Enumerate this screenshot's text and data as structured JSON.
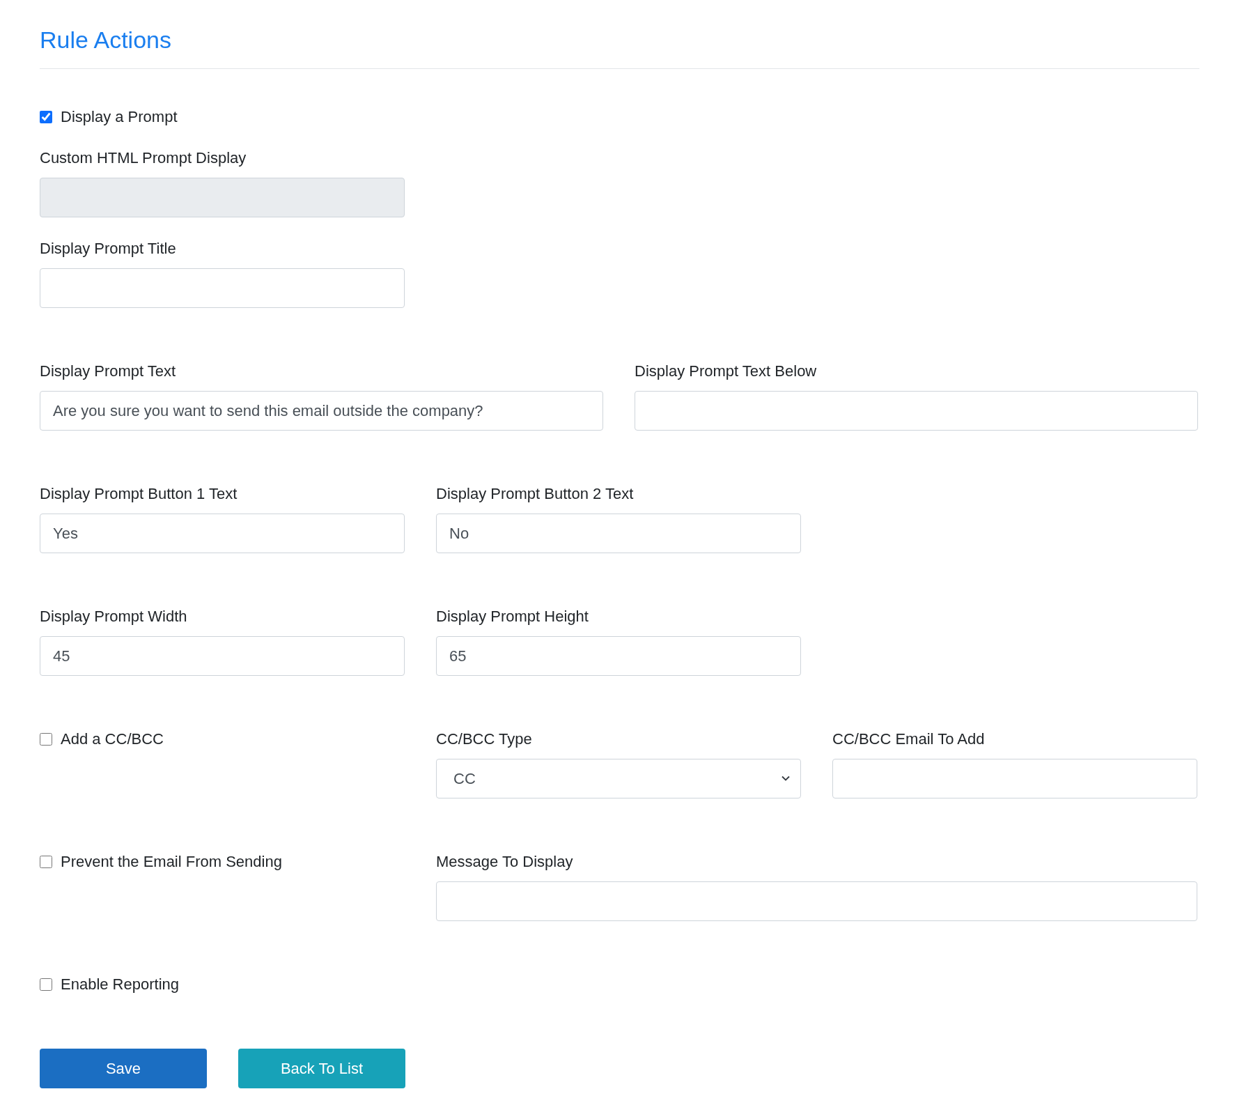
{
  "title": "Rule Actions",
  "display_prompt": {
    "label": "Display a Prompt",
    "checked": true
  },
  "custom_html": {
    "label": "Custom HTML Prompt Display",
    "disabled": true
  },
  "prompt_title": {
    "label": "Display Prompt Title",
    "disabled": false
  },
  "prompt_text": {
    "label": "Display Prompt Text",
    "value": "Are you sure you want to send this email outside the company?",
    "disabled": false
  },
  "prompt_text_below": {
    "label": "Display Prompt Text Below",
    "disabled": false
  },
  "button1_text": {
    "label": "Display Prompt Button 1 Text",
    "value": "Yes",
    "disabled": false
  },
  "button2_text": {
    "label": "Display Prompt Button 2 Text",
    "value": "No",
    "disabled": false
  },
  "prompt_width": {
    "label": "Display Prompt Width",
    "value": "45",
    "disabled": false
  },
  "prompt_height": {
    "label": "Display Prompt Height",
    "value": "65",
    "disabled": false
  },
  "add_cc_bcc": {
    "label": "Add a CC/BCC",
    "checked": false
  },
  "cc_bcc_type": {
    "label": "CC/BCC Type",
    "value": "CC"
  },
  "cc_bcc_email": {
    "label": "CC/BCC Email To Add",
    "disabled": false
  },
  "prevent_sending": {
    "label": "Prevent the Email From Sending",
    "checked": false
  },
  "message": {
    "label": "Message To Display",
    "disabled": false
  },
  "enable_reporting": {
    "label": "Enable Reporting",
    "checked": false
  },
  "buttons": [
    {
      "label": "Save",
      "kind": "primary"
    },
    {
      "label": "Back To List",
      "kind": "info"
    }
  ]
}
